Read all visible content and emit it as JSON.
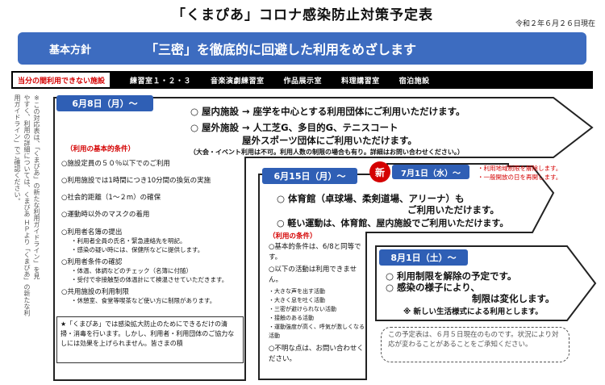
{
  "title": "「くまぴあ」コロナ感染防止対策予定表",
  "date": "令和２年６月２６日現在",
  "banner": {
    "label": "基本方針",
    "message": "「三密」を徹底的に回避した利用をめざします"
  },
  "restrict": {
    "label": "当分の間利用できない施設",
    "facilities": [
      "練習室１・２・３",
      "音楽演劇練習室",
      "作品展示室",
      "料理講習室",
      "宿泊施設"
    ]
  },
  "vertical_notes": [
    "※この対応表は、「くまぴあ」の新たな利用ガイドライン」を見",
    "やすく、利用の詳細については、くまぴあ ＨＰより「くまぴあ」の新たな利",
    "用ガイドライン」でご確認ください。"
  ],
  "phase1": {
    "header": "6月8日（月）〜",
    "lines": [
      "○ 屋内施設 → 座学を中心とする利用団体にご利用いただけます。",
      "○ 屋外施設 → 人工芝G、多目的G、テニスコート",
      "屋外スポーツ団体にご利用いただけます。"
    ],
    "note": "（大会・イベント利用は不可。利用人数の制限の場合も有り。詳細はお問い合わせください。）",
    "conditions_title": "（利用の基本的条件）",
    "conditions": [
      {
        "text": "○施設定員の５０％以下でのご利用",
        "sub": []
      },
      {
        "text": "○利用施設では1時間につき10分間の換気の実施",
        "sub": []
      },
      {
        "text": "○社会的距離（1〜２m）の確保",
        "sub": []
      },
      {
        "text": "○運動時以外のマスクの着用",
        "sub": []
      },
      {
        "text": "○利用者名簿の提出",
        "sub": [
          "・利用者全員の氏名・緊急連絡先を明記。",
          "・感染の疑い時には、保健所などに提供します。"
        ]
      },
      {
        "text": "○利用者条件の確認",
        "sub": [
          "・体温、体調などのチェック（名簿に付随）",
          "・受付で非接触型の体温計にて検温させていただきます。"
        ]
      },
      {
        "text": "○共用施設の利用制限",
        "sub": [
          "・休憩室、食堂等喫茶など使い方に制限があります。"
        ]
      }
    ],
    "footnote": "★「くまぴあ」では感染拡大防止のためにできるだけの清掃・消毒を行います。しかし、利用者・利用団体のご協力なしには効果を上げられません。皆さまの積"
  },
  "phase2": {
    "header": "6月15日（月）〜",
    "lines": [
      "○ 体育館（卓球場、柔剣道場、アリーナ）も",
      "ご利用いただけます。",
      "○ 軽い運動は、体育館、屋内施設でご利用いただけます。"
    ],
    "conditions_title": "（利用の条件）",
    "conditions": [
      "○基本的条件は、6/8と同等です。",
      "○以下の活動は利用できません。"
    ],
    "prohibited": [
      "・大きな声を出す活動",
      "・大きく息を吐く活動",
      "・三密が避けられない活動",
      "・接触のある活動",
      "・運動強度が高く、呼気が激しくなる活動"
    ],
    "inquiry": "○不明な点は、お問い合わせください。"
  },
  "phase_new": {
    "badge": "新",
    "header": "7月1日（水）〜",
    "notes": [
      "・利用地域制限を解除します。",
      "・一般開放の日を再開します。"
    ]
  },
  "phase3": {
    "header": "8月1日（土）〜",
    "lines": [
      "○ 利用制限を解除の予定です。",
      "○ 感染の様子により、",
      "制限は変化します。",
      "※ 新しい生活様式による利用とします。"
    ]
  },
  "schedule_note": "この予定表は、６月５日現在のものです。状況により対応が変わることがあることをご承知ください。"
}
